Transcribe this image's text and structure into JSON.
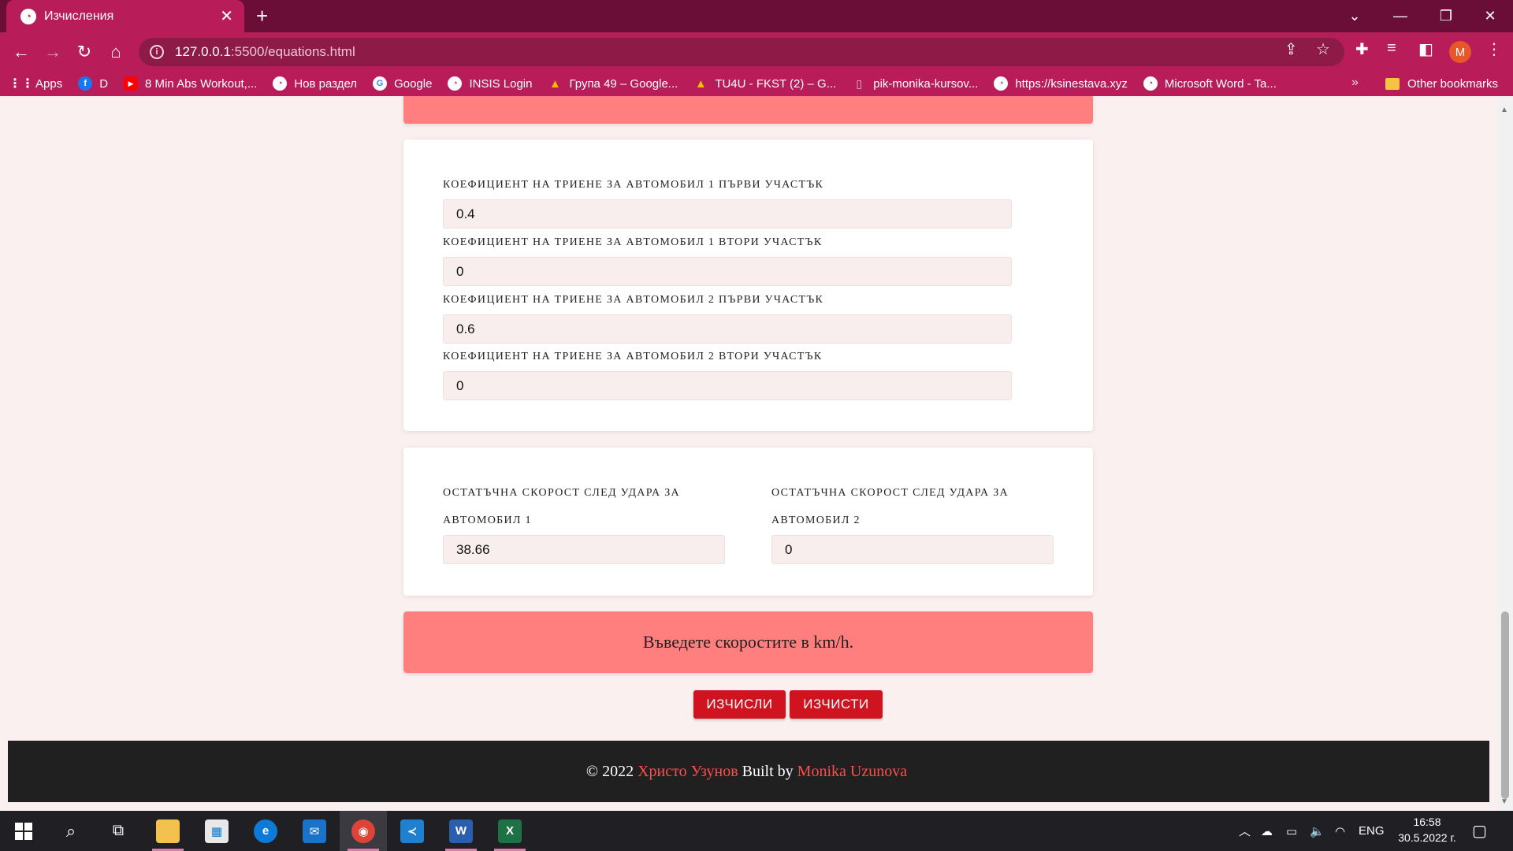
{
  "browser": {
    "tab_title": "Изчисления",
    "tab_favicon": "chrome-page-icon",
    "url_host": "127.0.0.1",
    "url_path": ":5500/equations.html",
    "profile_initial": "M",
    "bookmarks": [
      {
        "label": "Apps",
        "icon": "apps-grid-icon"
      },
      {
        "label": "D",
        "icon": "facebook-icon"
      },
      {
        "label": "8 Min Abs Workout,...",
        "icon": "youtube-icon"
      },
      {
        "label": "Нов раздел",
        "icon": "globe-icon"
      },
      {
        "label": "Google",
        "icon": "google-icon"
      },
      {
        "label": "INSIS Login",
        "icon": "globe-icon"
      },
      {
        "label": "Група 49 – Google...",
        "icon": "drive-icon"
      },
      {
        "label": "TU4U - FKST (2) – G...",
        "icon": "drive-icon"
      },
      {
        "label": "pik-monika-kursov...",
        "icon": "document-icon"
      },
      {
        "label": "https://ksinestava.xyz",
        "icon": "globe-icon"
      },
      {
        "label": "Microsoft Word - Ta...",
        "icon": "globe-icon"
      }
    ],
    "bookmarks_overflow": "»",
    "other_bookmarks": "Other bookmarks"
  },
  "friction": {
    "fields": [
      {
        "label": "Коефициент на триене за автомобил 1 първи участък",
        "value": "0.4"
      },
      {
        "label": "Коефициент на триене за автомобил 1 втори участък",
        "value": "0"
      },
      {
        "label": "Коефициент на триене за автомобил 2 първи участък",
        "value": "0.6"
      },
      {
        "label": "Коефициент на триене за автомобил 2 втори участък",
        "value": "0"
      }
    ]
  },
  "residual": {
    "car1": {
      "label_line1": "Остатъчна скорост след удара за",
      "label_line2": "автомобил 1",
      "value": "38.66"
    },
    "car2": {
      "label_line1": "Остатъчна скорост след удара за",
      "label_line2": "автомобил 2",
      "value": "0"
    }
  },
  "notice": "Въведете скоростите в km/h.",
  "buttons": {
    "calculate": "ИЗЧИСЛИ",
    "clear": "ИЗЧИСТИ"
  },
  "footer": {
    "prefix": "© 2022",
    "author": "Христо Узунов",
    "built_by": "Built by",
    "builder": "Monika Uzunova"
  },
  "taskbar": {
    "tray_lang": "ENG",
    "time": "16:58",
    "date": "30.5.2022 г."
  },
  "colors": {
    "chrome_dark": "#6a0e38",
    "chrome_accent": "#b81d5a",
    "banner": "#ff7f7f",
    "button": "#d0141f",
    "footer_bg": "#202020",
    "footer_link": "#ff4d4d"
  }
}
